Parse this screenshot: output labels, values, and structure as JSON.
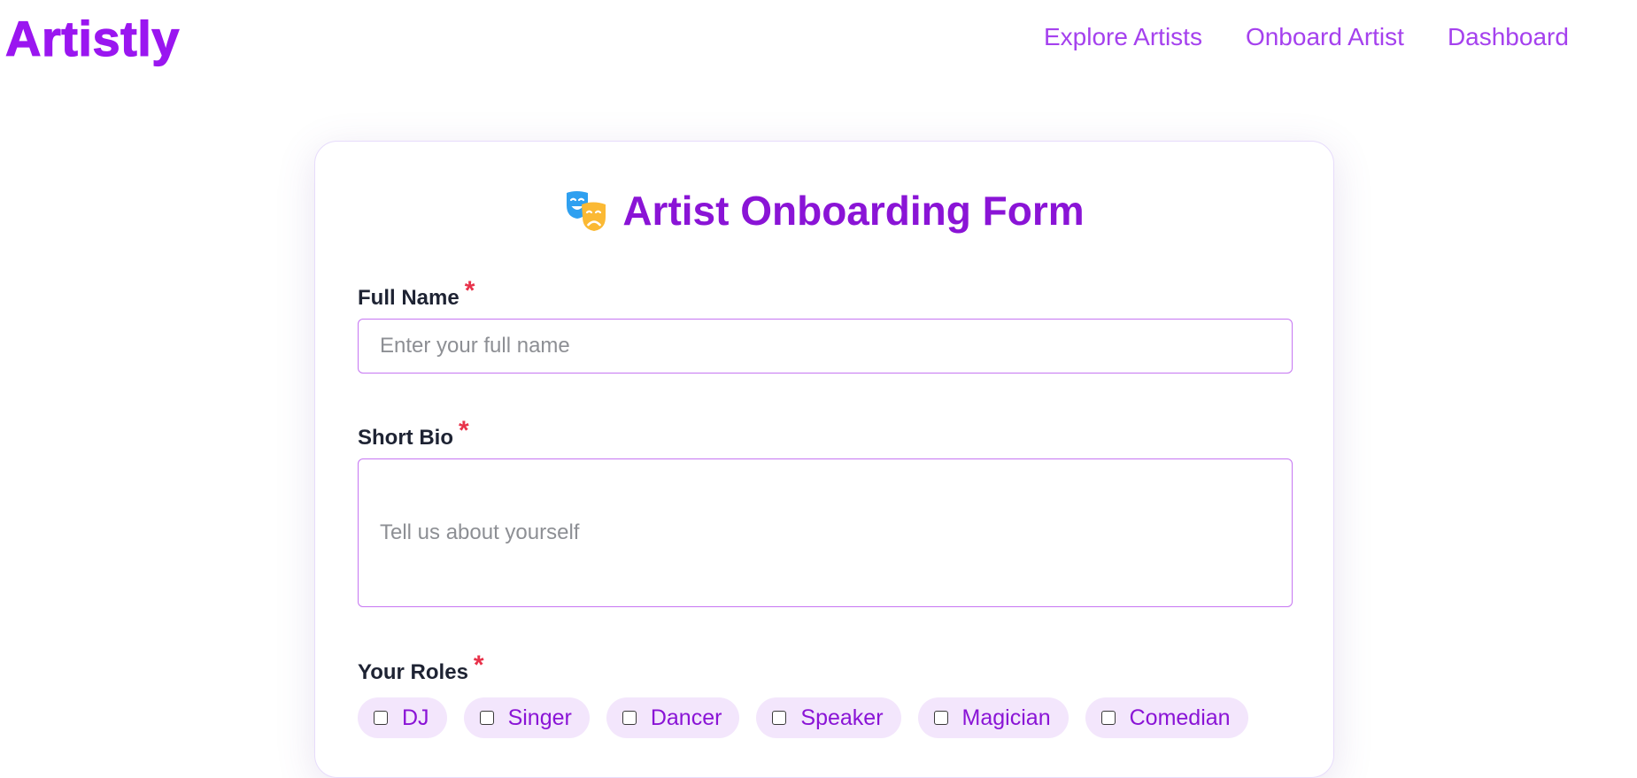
{
  "navbar": {
    "brand": "Artistly",
    "links": [
      "Explore Artists",
      "Onboard Artist",
      "Dashboard"
    ]
  },
  "form": {
    "title": "Artist Onboarding Form",
    "title_icon": "performing-arts-masks-icon",
    "required_marker": "*",
    "full_name": {
      "label": "Full Name",
      "placeholder": "Enter your full name",
      "value": ""
    },
    "bio": {
      "label": "Short Bio",
      "placeholder": "Tell us about yourself",
      "value": ""
    },
    "roles": {
      "label": "Your Roles",
      "options": [
        "DJ",
        "Singer",
        "Dancer",
        "Speaker",
        "Magician",
        "Comedian"
      ],
      "checked": [
        false,
        false,
        false,
        false,
        false,
        false
      ]
    }
  },
  "colors": {
    "brand": "#9a16f0",
    "nav_link": "#a541ee",
    "title": "#8a14d6",
    "input_border": "#c676f2",
    "required": "#e8324a",
    "chip_bg": "#f3e6fc"
  }
}
